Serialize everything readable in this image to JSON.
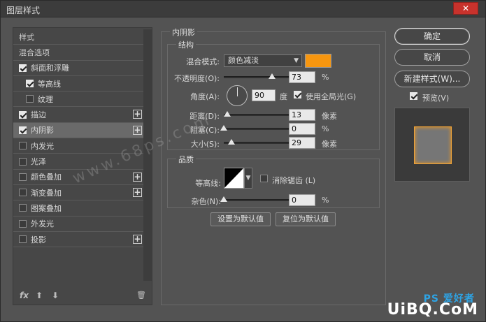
{
  "window": {
    "title": "图层样式",
    "close": "✕"
  },
  "styles_list": {
    "items": [
      {
        "label": "样式",
        "type": "header",
        "checked": null,
        "plus": false
      },
      {
        "label": "混合选项",
        "type": "header",
        "checked": null,
        "plus": false
      },
      {
        "label": "斜面和浮雕",
        "type": "item",
        "checked": true,
        "plus": false,
        "indent": 0
      },
      {
        "label": "等高线",
        "type": "item",
        "checked": true,
        "plus": false,
        "indent": 1
      },
      {
        "label": "纹理",
        "type": "item",
        "checked": false,
        "plus": false,
        "indent": 1
      },
      {
        "label": "描边",
        "type": "item",
        "checked": true,
        "plus": true,
        "indent": 0
      },
      {
        "label": "内阴影",
        "type": "item",
        "checked": true,
        "plus": true,
        "indent": 0,
        "selected": true
      },
      {
        "label": "内发光",
        "type": "item",
        "checked": false,
        "plus": false,
        "indent": 0
      },
      {
        "label": "光泽",
        "type": "item",
        "checked": false,
        "plus": false,
        "indent": 0
      },
      {
        "label": "颜色叠加",
        "type": "item",
        "checked": false,
        "plus": true,
        "indent": 0
      },
      {
        "label": "渐变叠加",
        "type": "item",
        "checked": false,
        "plus": true,
        "indent": 0
      },
      {
        "label": "图案叠加",
        "type": "item",
        "checked": false,
        "plus": false,
        "indent": 0
      },
      {
        "label": "外发光",
        "type": "item",
        "checked": false,
        "plus": false,
        "indent": 0
      },
      {
        "label": "投影",
        "type": "item",
        "checked": false,
        "plus": true,
        "indent": 0
      }
    ],
    "tools": {
      "fx": "fx",
      "up": "⬆",
      "down": "⬇",
      "trash": "🗑"
    }
  },
  "inner_shadow": {
    "title": "内阴影",
    "structure": {
      "title": "结构",
      "blend_mode_label": "混合模式:",
      "blend_mode_value": "颜色减淡",
      "color": "#f7960f",
      "opacity_label": "不透明度(O):",
      "opacity_value": "73",
      "opacity_unit": "%",
      "opacity_fraction": 0.73,
      "angle_label": "角度(A):",
      "angle_value": "90",
      "angle_unit": "度",
      "global_light_label": "使用全局光(G)",
      "global_light_checked": true,
      "distance_label": "距离(D):",
      "distance_value": "13",
      "distance_unit": "像素",
      "distance_fraction": 0.05,
      "choke_label": "阻塞(C):",
      "choke_value": "0",
      "choke_unit": "%",
      "choke_fraction": 0.0,
      "size_label": "大小(S):",
      "size_value": "29",
      "size_unit": "像素",
      "size_fraction": 0.12
    },
    "quality": {
      "title": "品质",
      "contour_label": "等高线:",
      "antialias_label": "消除锯齿 (L)",
      "antialias_checked": false,
      "noise_label": "杂色(N):",
      "noise_value": "0",
      "noise_unit": "%",
      "noise_fraction": 0.0
    },
    "set_default": "设置为默认值",
    "reset_default": "复位为默认值"
  },
  "right": {
    "ok": "确定",
    "cancel": "取消",
    "new_style": "新建样式(W)...",
    "preview_label": "预览(V)",
    "preview_checked": true
  },
  "watermark": "www.68ps.com",
  "logo": {
    "text": "UiBQ.CoM",
    "ps": "PS 爱好者"
  }
}
